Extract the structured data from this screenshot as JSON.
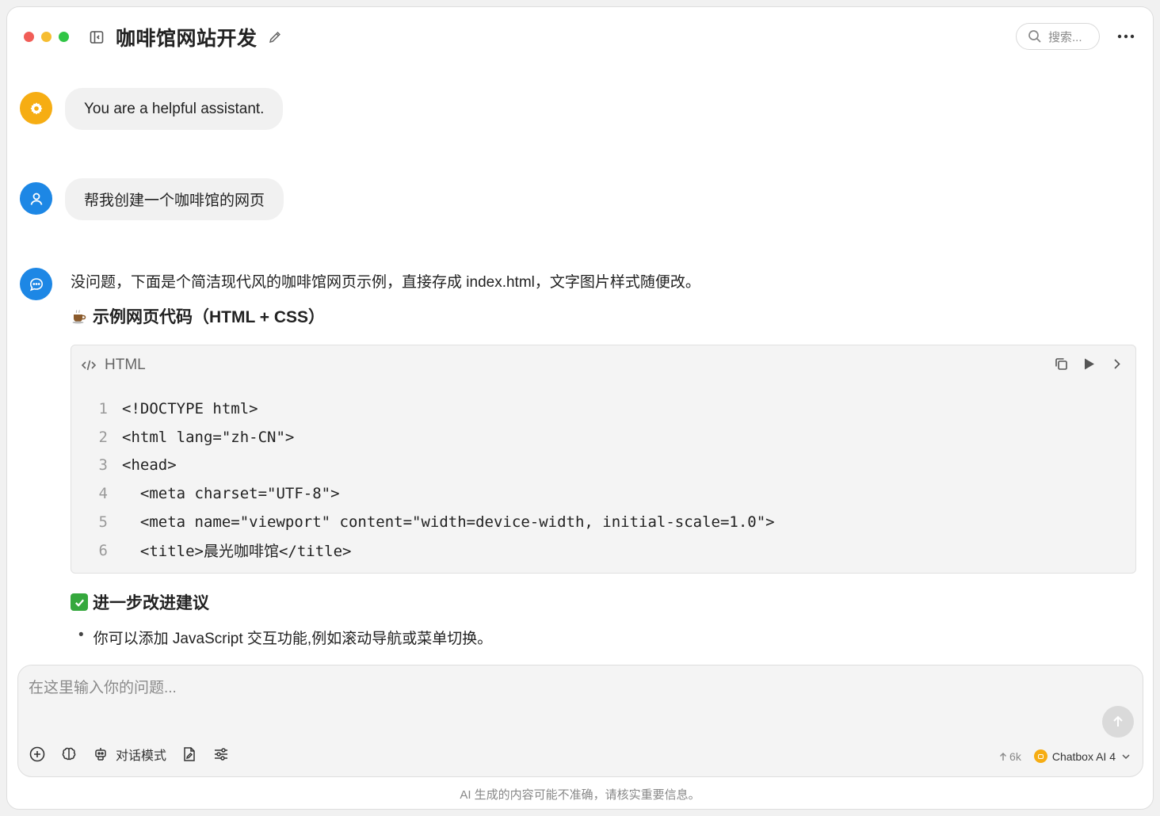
{
  "header": {
    "title": "咖啡馆网站开发",
    "search_placeholder": "搜索..."
  },
  "messages": {
    "system": "You are a helpful assistant.",
    "user": "帮我创建一个咖啡馆的网页",
    "assistant": {
      "intro": "没问题，下面是个简洁现代风的咖啡馆网页示例，直接存成 index.html，文字图片样式随便改。",
      "heading1": "示例网页代码（HTML + CSS）",
      "code": {
        "language": "HTML",
        "lines": [
          {
            "n": "1",
            "text": "<!DOCTYPE html>"
          },
          {
            "n": "2",
            "text": "<html lang=\"zh-CN\">"
          },
          {
            "n": "3",
            "text": "<head>"
          },
          {
            "n": "4",
            "text": "  <meta charset=\"UTF-8\">"
          },
          {
            "n": "5",
            "text": "  <meta name=\"viewport\" content=\"width=device-width, initial-scale=1.0\">"
          },
          {
            "n": "6",
            "text": "  <title>晨光咖啡馆</title>"
          }
        ]
      },
      "heading2": "进一步改进建议",
      "suggestion": "你可以添加 JavaScript 交互功能,例如滚动导航或菜单切换。"
    }
  },
  "composer": {
    "placeholder": "在这里输入你的问题...",
    "mode_label": "对话模式",
    "tokens": "6k",
    "model": "Chatbox AI 4"
  },
  "footer": {
    "disclaimer": "AI 生成的内容可能不准确，请核实重要信息。"
  },
  "colors": {
    "system_avatar": "#f6ad13",
    "user_avatar": "#1d87e5",
    "assistant_avatar": "#1d87e5"
  }
}
